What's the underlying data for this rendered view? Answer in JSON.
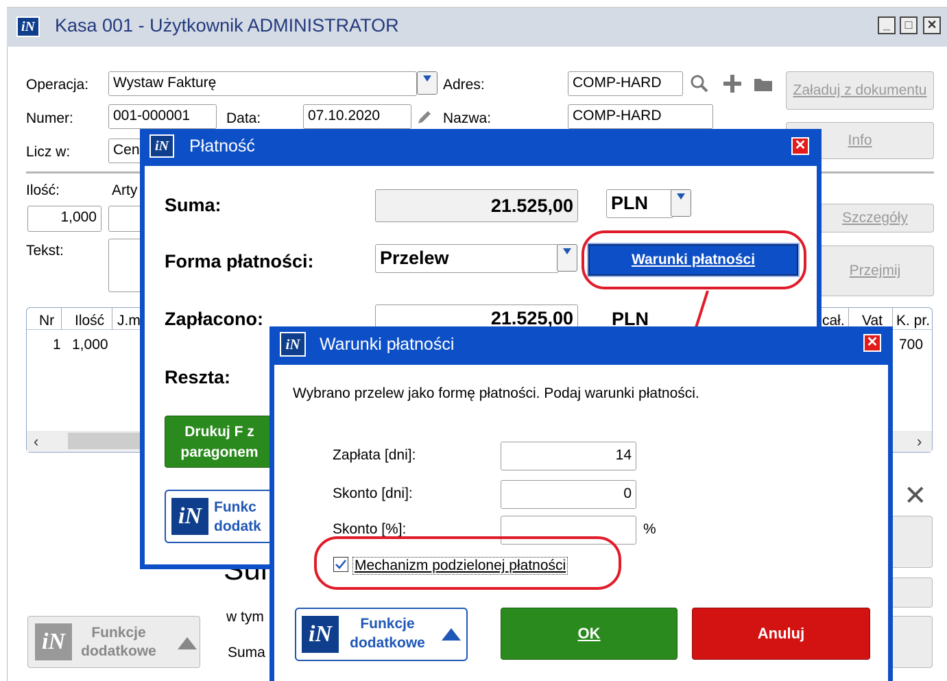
{
  "window": {
    "title": "Kasa 001 - Użytkownik ADMINISTRATOR",
    "logo": "iN",
    "min": "_",
    "max": "□",
    "close": "✕"
  },
  "form": {
    "operacja_label": "Operacja:",
    "operacja_value": "Wystaw Fakturę",
    "adres_label": "Adres:",
    "adres_value": "COMP-HARD",
    "numer_label": "Numer:",
    "numer_value": "001-000001",
    "data_label": "Data:",
    "data_value": "07.10.2020",
    "nazwa_label": "Nazwa:",
    "nazwa_value": "COMP-HARD",
    "licz_label": "Licz w:",
    "licz_value": "Cen",
    "ilosc_label": "Ilość:",
    "ilosc_value": "1,000",
    "arty_label": "Arty",
    "tekst_label": "Tekst:"
  },
  "buttons": {
    "zaladuj": "Załaduj z dokumentu",
    "info": "Info",
    "szczegoly": "Szczegóły",
    "przejmij": "Przejmij",
    "funkcje": "Funkcje dodatkowe"
  },
  "table": {
    "headers": [
      "Nr",
      "Ilość",
      "J.m"
    ],
    "right_headers": [
      "cał.",
      "Vat",
      "K. pr."
    ],
    "row": {
      "nr": "1",
      "ilosc": "1,000",
      "kpr": "700"
    },
    "scroll_left": "‹",
    "scroll_right": "›"
  },
  "bottom": {
    "suma": "Sum",
    "wtym": "w tym",
    "suma2": "Suma",
    "x": "✕"
  },
  "platnosc": {
    "title": "Płatność",
    "logo": "iN",
    "close": "✕",
    "suma_label": "Suma:",
    "suma_value": "21.525,00",
    "currency": "PLN",
    "forma_label": "Forma płatności:",
    "forma_value": "Przelew",
    "warunki_btn": "Warunki płatności",
    "zaplacono_label": "Zapłacono:",
    "zaplacono_value": "21.525,00",
    "zaplacono_currency": "PLN",
    "reszta_label": "Reszta:",
    "drukuj_btn": "Drukuj F z paragonem",
    "funkcje_btn": "Funkc dodatk"
  },
  "warunki": {
    "title": "Warunki płatności",
    "logo": "iN",
    "close": "✕",
    "message": "Wybrano przelew jako formę płatności. Podaj warunki płatności.",
    "zaplata_label": "Zapłata [dni]:",
    "zaplata_value": "14",
    "sk_dni_label": "Skonto [dni]:",
    "sk_dni_value": "0",
    "sk_proc_label": "Skonto [%]:",
    "sk_proc_value": "",
    "percent": "%",
    "mechanizm_label": "Mechanizm podzielonej płatności",
    "mechanizm_checked": true,
    "funkcje_btn": "Funkcje dodatkowe",
    "ok_btn": "OK",
    "anuluj_btn": "Anuluj"
  },
  "colors": {
    "dialog_blue": "#0d4fc6",
    "ok_green": "#2a8a1d",
    "cancel_red": "#d31212",
    "highlight": "#e11c2a"
  }
}
